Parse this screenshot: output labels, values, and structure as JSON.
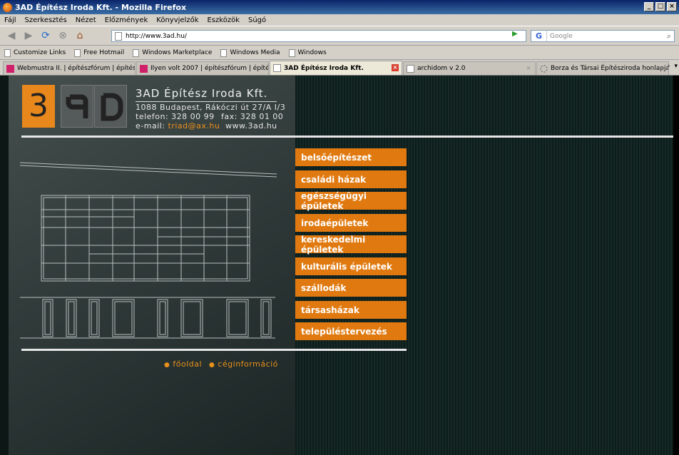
{
  "window": {
    "title": "3AD Építész Iroda Kft. - Mozilla Firefox",
    "controls": [
      "_",
      "□",
      "×"
    ]
  },
  "menu": [
    "Fájl",
    "Szerkesztés",
    "Nézet",
    "Előzmények",
    "Könyvjelzők",
    "Eszközök",
    "Súgó"
  ],
  "address": {
    "url": "http://www.3ad.hu/"
  },
  "search": {
    "placeholder": "Google",
    "engine": "G"
  },
  "bookmarks": [
    "Customize Links",
    "Free Hotmail",
    "Windows Marketplace",
    "Windows Media",
    "Windows"
  ],
  "tabs": [
    {
      "label": "Webmustra II. | építészfórum | építés...",
      "active": false
    },
    {
      "label": "Ilyen volt 2007 | építészfórum | építés...",
      "active": false
    },
    {
      "label": "3AD Építész Iroda Kft.",
      "active": true
    },
    {
      "label": "archidom v 2.0",
      "active": false
    },
    {
      "label": "Borza és Társai Építésziroda honlapja",
      "active": false
    }
  ],
  "site": {
    "logo_digit": "3",
    "company": "3AD Építész Iroda Kft.",
    "address": "1088 Budapest, Rákóczi út 27/A I/3",
    "phone": "telefon: 328 00 99",
    "fax": "fax: 328 01 00",
    "email_label": "e-mail:",
    "email": "triad@ax.hu",
    "web": "www.3ad.hu",
    "menu": [
      "belsőépítészet",
      "családi házak",
      "egészségügyi épületek",
      "irodaépületek",
      "kereskedelmi épületek",
      "kulturális épületek",
      "szállodák",
      "társasházak",
      "településtervezés"
    ],
    "footer": [
      "főoldal",
      "céginformáció"
    ]
  },
  "colors": {
    "accent": "#e07a10",
    "background": "#0d1716"
  }
}
